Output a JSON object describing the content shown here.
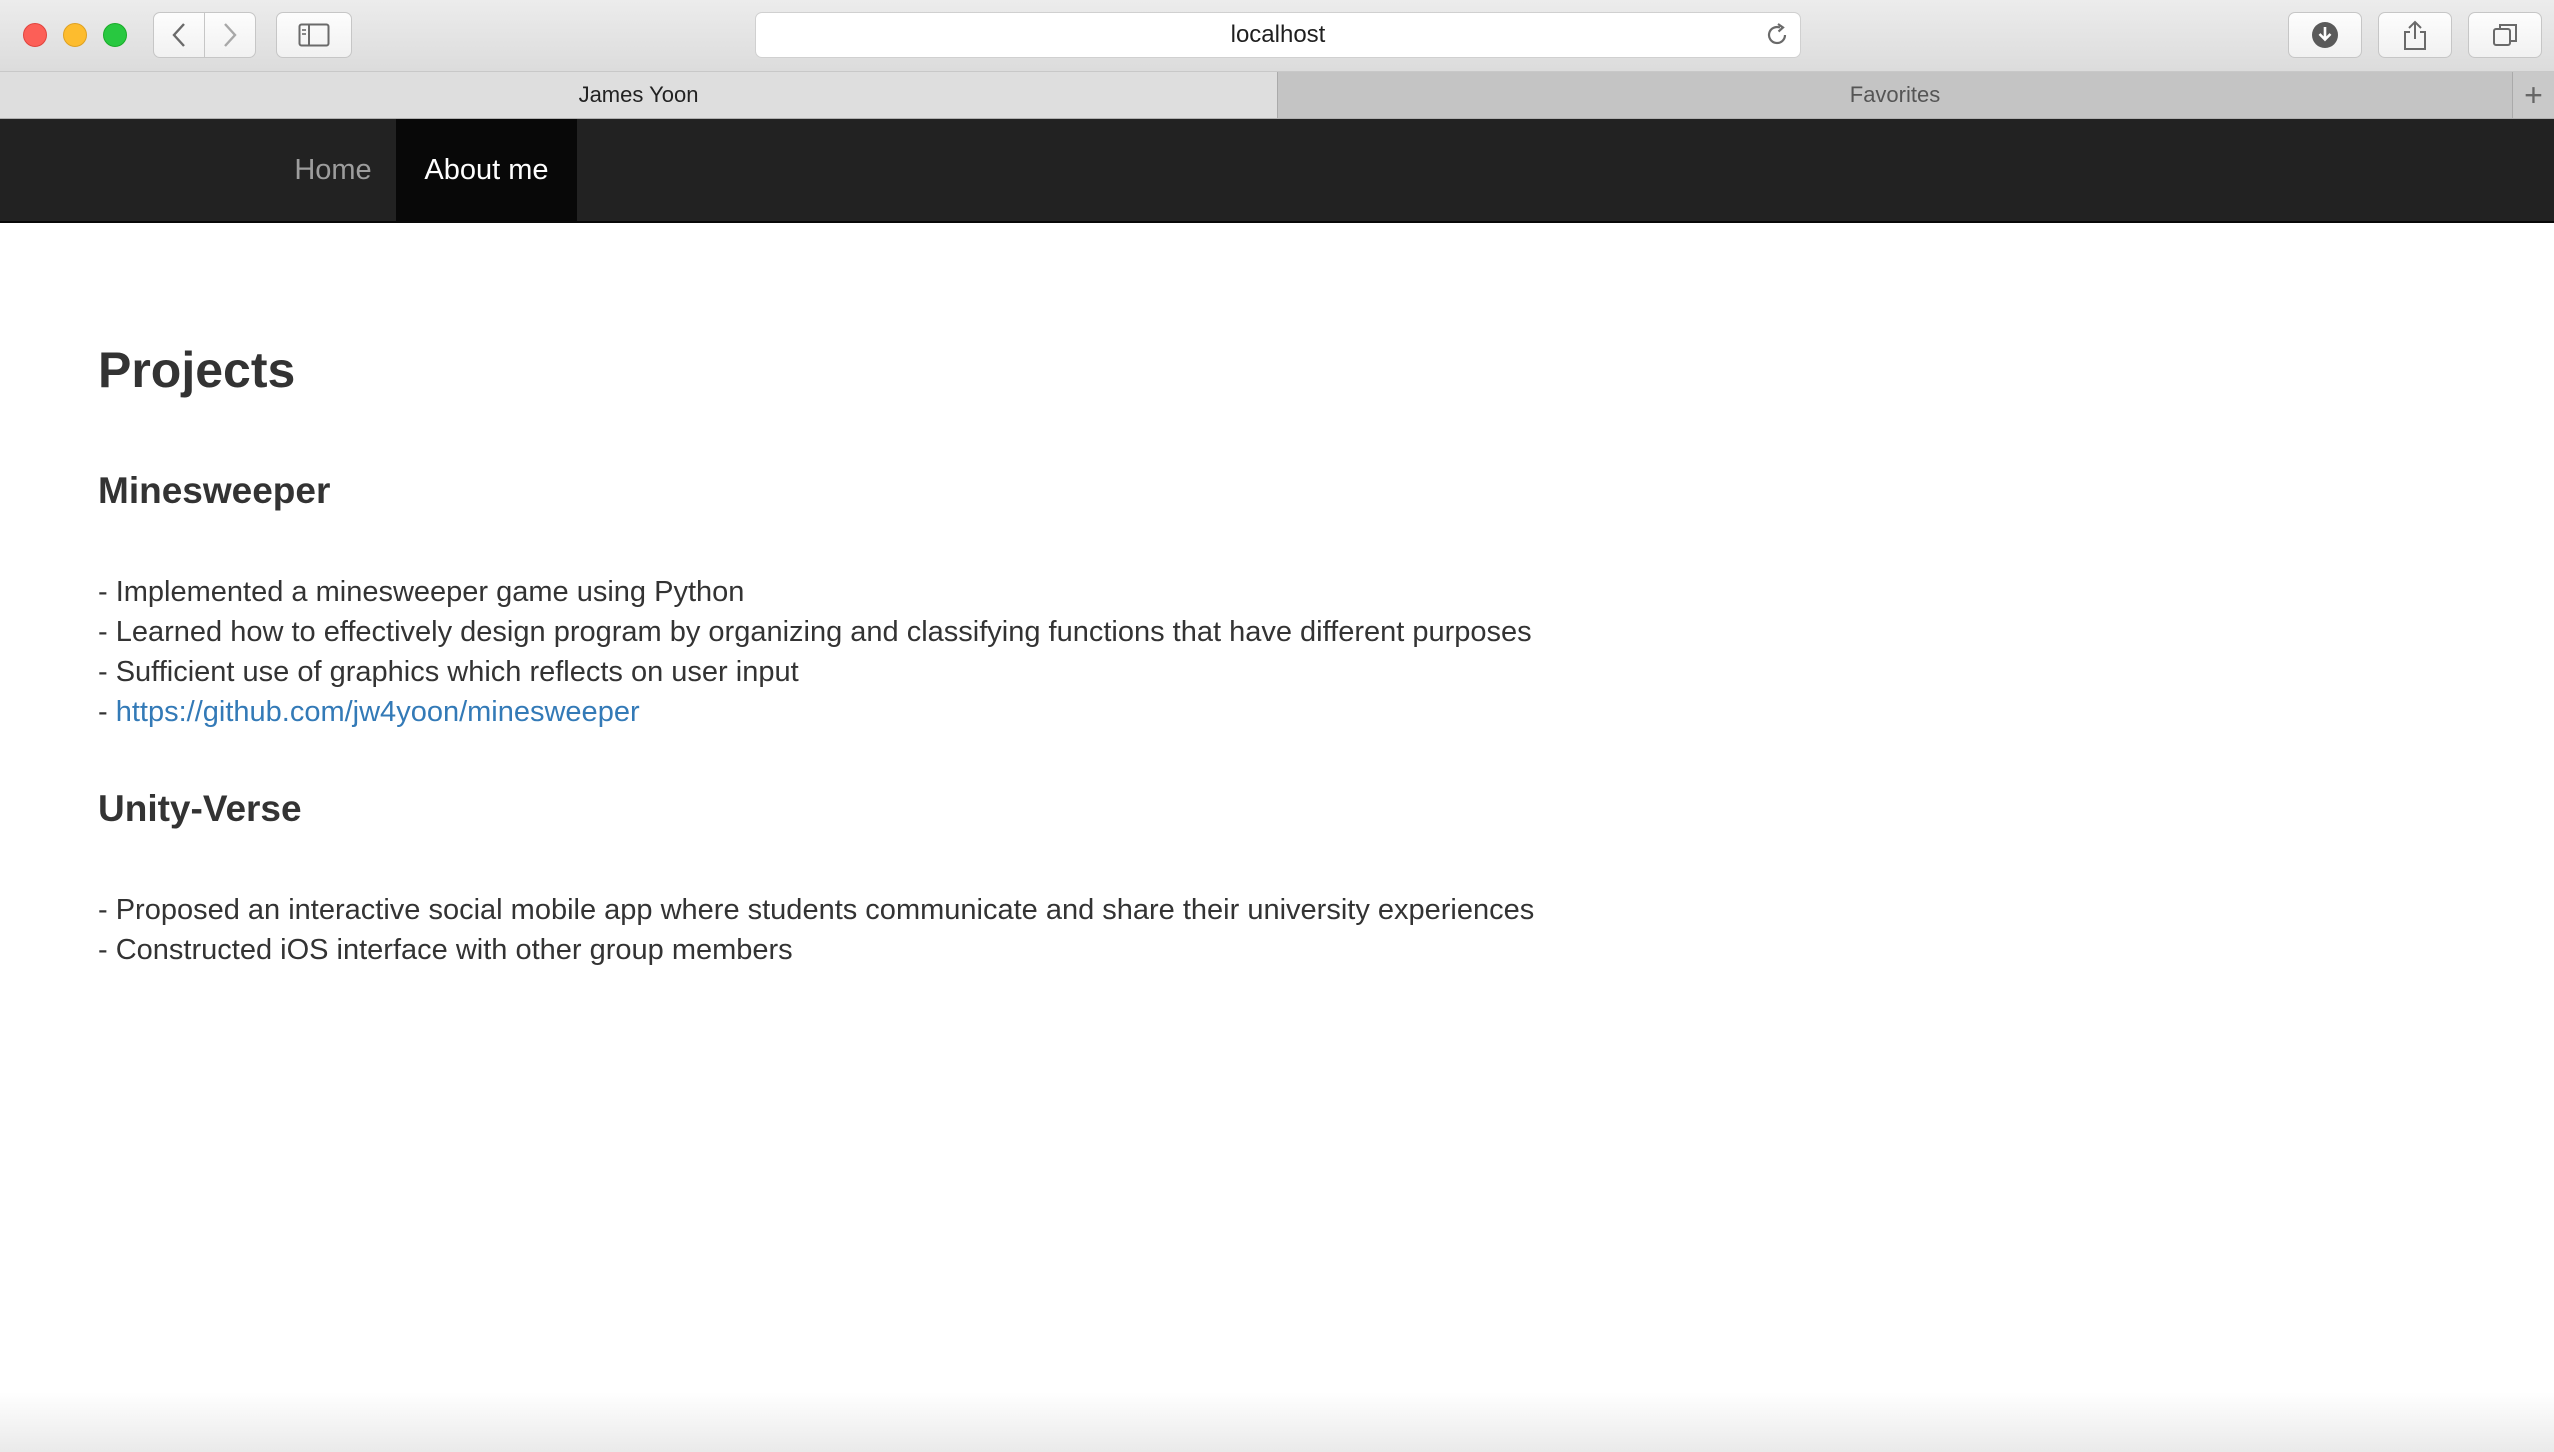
{
  "browser": {
    "url": "localhost",
    "tabs": [
      {
        "label": "James Yoon",
        "active": true
      },
      {
        "label": "Favorites",
        "active": false
      }
    ],
    "new_tab_label": "+"
  },
  "navbar": {
    "items": [
      {
        "label": "Home",
        "active": false
      },
      {
        "label": "About me",
        "active": true
      }
    ]
  },
  "page": {
    "title": "Projects",
    "projects": [
      {
        "name": "Minesweeper",
        "lines": [
          "- Implemented a minesweeper game using Python",
          "- Learned how to effectively design program by organizing and classifying functions that have different purposes",
          "- Sufficient use of graphics which reflects on user input"
        ],
        "link_prefix": "- ",
        "link": "https://github.com/jw4yoon/minesweeper"
      },
      {
        "name": "Unity-Verse",
        "lines": [
          "- Proposed an interactive social mobile app where students communicate and share their university experiences",
          "- Constructed iOS interface with other group members"
        ]
      }
    ]
  },
  "colors": {
    "navbar_bg": "#222222",
    "navbar_active_bg": "#080808",
    "link": "#337ab7",
    "text": "#333333"
  }
}
